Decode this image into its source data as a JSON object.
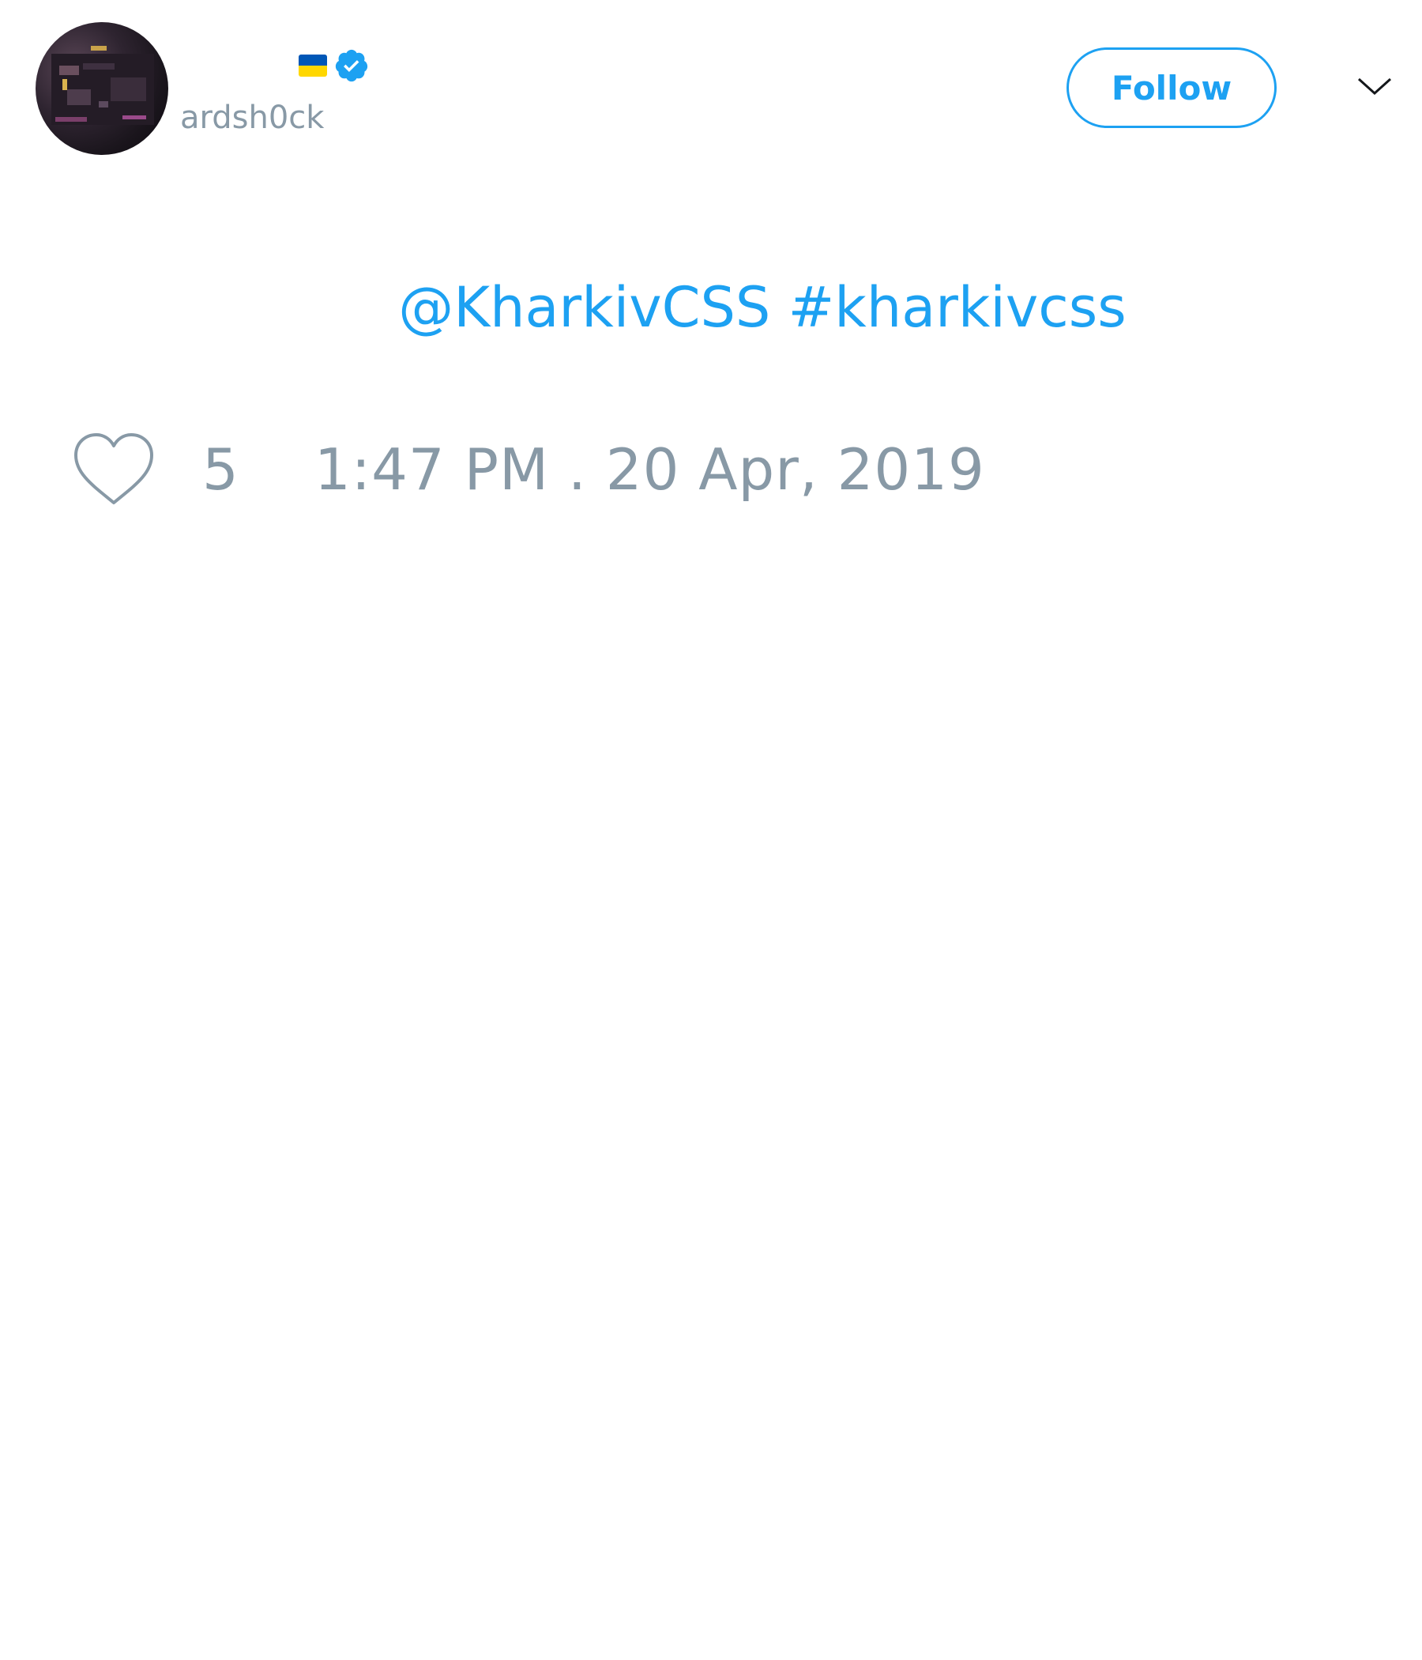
{
  "author": {
    "handle": "ardsh0ck",
    "flag_icon": "ukraine-flag-icon",
    "verified_icon": "verified-badge-icon"
  },
  "header": {
    "follow_label": "Follow",
    "menu_icon": "chevron-down-icon"
  },
  "tweet": {
    "mention": "@KharkivCSS",
    "hashtag": "#kharkivcss"
  },
  "footer": {
    "like_icon": "heart-icon",
    "like_count": "5",
    "timestamp": "1:47 PM . 20 Apr, 2019"
  },
  "colors": {
    "accent": "#1da1f2",
    "muted": "#8899a6",
    "flag_blue": "#0057b7",
    "flag_yellow": "#ffd700"
  }
}
